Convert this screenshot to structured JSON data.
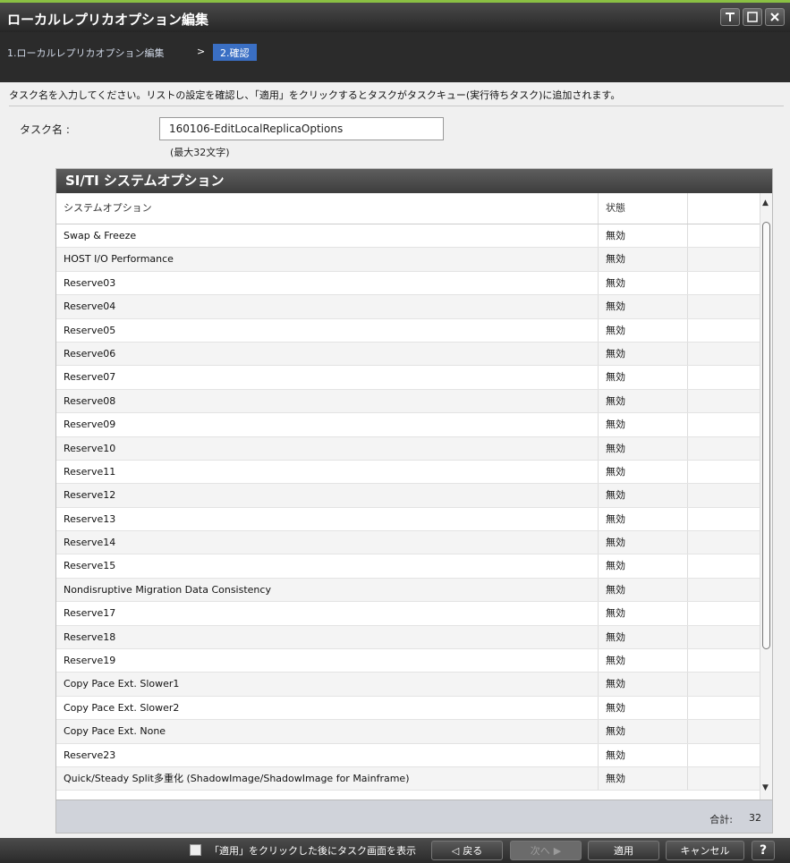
{
  "window": {
    "title": "ローカルレプリカオプション編集",
    "buttons": [
      "pin",
      "maximize",
      "close"
    ]
  },
  "breadcrumb": {
    "step1": "1.ローカルレプリカオプション編集",
    "separator": ">",
    "step2": "2.確認"
  },
  "instruction": "タスク名を入力してください。リストの設定を確認し、「適用」をクリックするとタスクがタスクキュー(実行待ちタスク)に追加されます。",
  "task": {
    "label": "タスク名 :",
    "value": "160106-EditLocalReplicaOptions",
    "hint": "(最大32文字)"
  },
  "panel": {
    "title": "SI/TI システムオプション",
    "columns": {
      "option": "システムオプション",
      "status": "状態"
    },
    "rows": [
      {
        "option": "Swap & Freeze",
        "status": "無効"
      },
      {
        "option": "HOST I/O Performance",
        "status": "無効"
      },
      {
        "option": "Reserve03",
        "status": "無効"
      },
      {
        "option": "Reserve04",
        "status": "無効"
      },
      {
        "option": "Reserve05",
        "status": "無効"
      },
      {
        "option": "Reserve06",
        "status": "無効"
      },
      {
        "option": "Reserve07",
        "status": "無効"
      },
      {
        "option": "Reserve08",
        "status": "無効"
      },
      {
        "option": "Reserve09",
        "status": "無効"
      },
      {
        "option": "Reserve10",
        "status": "無効"
      },
      {
        "option": "Reserve11",
        "status": "無効"
      },
      {
        "option": "Reserve12",
        "status": "無効"
      },
      {
        "option": "Reserve13",
        "status": "無効"
      },
      {
        "option": "Reserve14",
        "status": "無効"
      },
      {
        "option": "Reserve15",
        "status": "無効"
      },
      {
        "option": "Nondisruptive Migration Data Consistency",
        "status": "無効"
      },
      {
        "option": "Reserve17",
        "status": "無効"
      },
      {
        "option": "Reserve18",
        "status": "無効"
      },
      {
        "option": "Reserve19",
        "status": "無効"
      },
      {
        "option": "Copy Pace Ext. Slower1",
        "status": "無効"
      },
      {
        "option": "Copy Pace Ext. Slower2",
        "status": "無効"
      },
      {
        "option": "Copy Pace Ext. None",
        "status": "無効"
      },
      {
        "option": "Reserve23",
        "status": "無効"
      },
      {
        "option": "Quick/Steady Split多重化 (ShadowImage/ShadowImage for Mainframe)",
        "status": "無効"
      }
    ],
    "total_label": "合計:",
    "total_count": "32"
  },
  "footer": {
    "checkbox_label": "「適用」をクリックした後にタスク画面を表示",
    "back": "戻る",
    "next": "次へ",
    "apply": "適用",
    "cancel": "キャンセル",
    "help": "?"
  }
}
